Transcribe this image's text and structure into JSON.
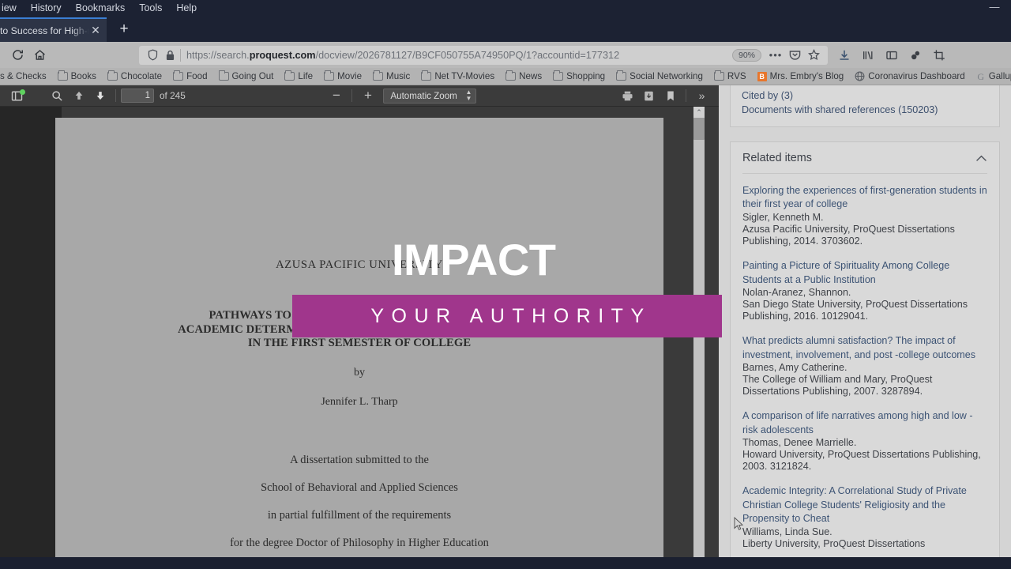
{
  "window": {
    "minimize_label": "—"
  },
  "menubar": {
    "items": [
      {
        "label": "iew"
      },
      {
        "label": "History"
      },
      {
        "label": "Bookmarks"
      },
      {
        "label": "Tools"
      },
      {
        "label": "Help"
      }
    ]
  },
  "tabs": {
    "active_title": "to Success for High-r",
    "close_label": "✕",
    "new_tab_label": "+"
  },
  "toolbar": {
    "reload_label": "⟳",
    "home_label": "⌂",
    "url_display_pre": "https://search.",
    "url_display_bold": "proquest.com",
    "url_display_post": "/docview/2026781127/B9CF050755A74950PQ/1?accountid=177312",
    "url_full": "https://search.proquest.com/docview/2026781127/B9CF050755A74950PQ/1?accountid=177312",
    "zoom_badge": "90%",
    "more_label": "•••",
    "pocket_label": "pocket-icon",
    "bookmark_star_label": "☆",
    "right_icons": [
      "download-icon",
      "library-icon",
      "sidebar-icon",
      "containers-icon",
      "screenshot-icon"
    ]
  },
  "bookmarks": {
    "items": [
      {
        "label": "s & Checks",
        "icon": "none",
        "truncated": true
      },
      {
        "label": "Books",
        "icon": "folder"
      },
      {
        "label": "Chocolate",
        "icon": "folder"
      },
      {
        "label": "Food",
        "icon": "folder"
      },
      {
        "label": "Going Out",
        "icon": "folder"
      },
      {
        "label": "Life",
        "icon": "folder"
      },
      {
        "label": "Movie",
        "icon": "folder"
      },
      {
        "label": "Music",
        "icon": "folder"
      },
      {
        "label": "Net TV-Movies",
        "icon": "folder"
      },
      {
        "label": "News",
        "icon": "folder"
      },
      {
        "label": "Shopping",
        "icon": "folder"
      },
      {
        "label": "Social Networking",
        "icon": "folder"
      },
      {
        "label": "RVS",
        "icon": "folder"
      },
      {
        "label": "Mrs. Embry's Blog",
        "icon": "orange-favicon"
      },
      {
        "label": "Coronavirus Dashboard",
        "icon": "globe-favicon"
      },
      {
        "label": "Gallup | Analytics a",
        "icon": "g-favicon"
      }
    ]
  },
  "pdf_toolbar": {
    "sidebar_toggle": "sidebar-toggle-icon",
    "find_label": "search-icon",
    "prev_page_label": "up-arrow-icon",
    "next_page_label": "down-arrow-icon",
    "page_number": "1",
    "page_total": "of 245",
    "zoom_out_label": "−",
    "zoom_in_label": "+",
    "zoom_select": "Automatic Zoom",
    "print_label": "print-icon",
    "save_label": "download-icon",
    "bookmark_label": "bookmark-icon",
    "more_tools_label": "»"
  },
  "document": {
    "university": "AZUSA PACIFIC UNIVERSITY",
    "title_line1": "PATHWAYS TO SUCCESS FOR HIGH-RISK STUDENTS:",
    "title_line2": "ACADEMIC DETERMINATION AND INSTITUTIONAL INTEGRITY",
    "title_line3": "IN THE FIRST SEMESTER OF COLLEGE",
    "by_label": "by",
    "author": "Jennifer L. Tharp",
    "sub_line1": "A dissertation submitted to the",
    "sub_line2": "School of Behavioral and Applied Sciences",
    "sub_line3": "in partial fulfillment of the requirements",
    "sub_line4": "for the degree Doctor of Philosophy in Higher Education"
  },
  "overlay": {
    "headline": "IMPACT",
    "subhead": "YOUR AUTHORITY",
    "bar_color": "#a0368c",
    "text_color": "#ffffff"
  },
  "sidebar": {
    "cited_by": "Cited by (3)",
    "shared_references": "Documents with shared references (150203)",
    "related_title": "Related items",
    "collapse_icon": "chevron-up-icon",
    "related_items": [
      {
        "title": "Exploring the experiences of first-generation students in their first year of college",
        "author": "Sigler, Kenneth M.",
        "source": "Azusa Pacific University, ProQuest Dissertations Publishing, 2014. 3703602."
      },
      {
        "title": "Painting a Picture of Spirituality Among College Students at a Public Institution",
        "author": "Nolan-Aranez, Shannon.",
        "source": "San Diego State University, ProQuest Dissertations Publishing, 2016. 10129041."
      },
      {
        "title": "What predicts alumni satisfaction? The impact of investment, involvement, and post -college outcomes",
        "author": "Barnes, Amy Catherine.",
        "source": "The College of William and Mary, ProQuest Dissertations Publishing, 2007. 3287894."
      },
      {
        "title": "A comparison of life narratives among high and low -risk adolescents",
        "author": "Thomas, Denee Marrielle.",
        "source": "Howard University, ProQuest Dissertations Publishing, 2003. 3121824."
      },
      {
        "title": "Academic Integrity: A Correlational Study of Private Christian College Students' Religiosity and the Propensity to Cheat",
        "author": "Williams, Linda Sue.",
        "source": "Liberty University, ProQuest Dissertations"
      }
    ]
  }
}
